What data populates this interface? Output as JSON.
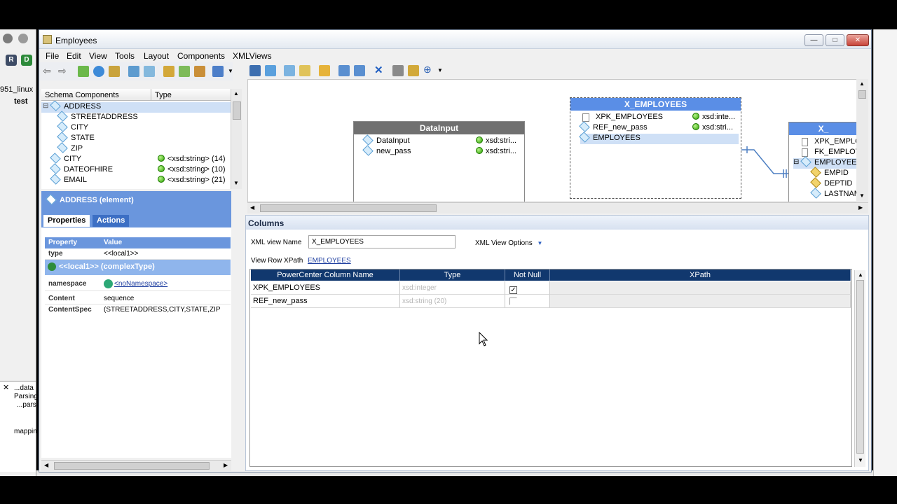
{
  "window": {
    "title": "Employees"
  },
  "menu": [
    "File",
    "Edit",
    "View",
    "Tools",
    "Layout",
    "Components",
    "XMLViews"
  ],
  "background": {
    "left_labels": [
      "951_linux",
      "test"
    ],
    "output_labels": [
      "...data",
      "Parsing",
      "...parsi",
      "mappin"
    ]
  },
  "schema": {
    "col_components": "Schema Components",
    "col_type": "Type",
    "rows": [
      {
        "name": "ADDRESS",
        "type": "",
        "indent": 0,
        "selected": true,
        "expand": "⊟"
      },
      {
        "name": "STREETADDRESS",
        "type": "",
        "indent": 1
      },
      {
        "name": "CITY",
        "type": "",
        "indent": 1
      },
      {
        "name": "STATE",
        "type": "",
        "indent": 1
      },
      {
        "name": "ZIP",
        "type": "",
        "indent": 1
      },
      {
        "name": "CITY",
        "type": "<xsd:string> (14)",
        "indent": 0
      },
      {
        "name": "DATEOFHIRE",
        "type": "<xsd:string> (10)",
        "indent": 0
      },
      {
        "name": "EMAIL",
        "type": "<xsd:string> (21)",
        "indent": 0
      }
    ]
  },
  "properties": {
    "header": "ADDRESS (element)",
    "tabs": [
      "Properties",
      "Actions"
    ],
    "col_property": "Property",
    "col_value": "Value",
    "type_label": "type",
    "type_value": "<<local1>>",
    "complex_label": "<<local1>> (complexType)",
    "namespace_label": "namespace",
    "namespace_value": "<noNamespace>",
    "content_label": "Content",
    "content_value": "sequence",
    "contentspec_label": "ContentSpec",
    "contentspec_value": "(STREETADDRESS,CITY,STATE,ZIP"
  },
  "canvas": {
    "datainput": {
      "title": "DataInput",
      "rows": [
        {
          "name": "DataInput",
          "type": "xsd:stri..."
        },
        {
          "name": "new_pass",
          "type": "xsd:stri..."
        }
      ]
    },
    "x_employees": {
      "title": "X_EMPLOYEES",
      "rows": [
        {
          "name": "XPK_EMPLOYEES",
          "type": "xsd:inte..."
        },
        {
          "name": "REF_new_pass",
          "type": "xsd:stri..."
        },
        {
          "name": "EMPLOYEES",
          "type": ""
        }
      ]
    },
    "x_partial": {
      "title": "X_",
      "rows": [
        "XPK_EMPLO",
        "FK_EMPLOY",
        "EMPLOYEE",
        "EMPID",
        "DEPTID",
        "LASTNAM"
      ]
    }
  },
  "columns": {
    "title": "Columns",
    "xml_view_name_label": "XML view Name",
    "xml_view_name_value": "X_EMPLOYEES",
    "options_label": "XML View Options",
    "row_xpath_label": "View Row XPath",
    "row_xpath_value": "EMPLOYEES",
    "headers": [
      "PowerCenter Column Name",
      "Type",
      "Not Null",
      "XPath"
    ],
    "rows": [
      {
        "name": "XPK_EMPLOYEES",
        "type": "xsd:integer",
        "not_null": true,
        "xpath": ""
      },
      {
        "name": "REF_new_pass",
        "type": "xsd:string (20)",
        "not_null": false,
        "xpath": ""
      }
    ]
  },
  "colors": {
    "accent": "#6a96dd",
    "grid_header": "#11386e",
    "selection": "#cfe0f6"
  }
}
